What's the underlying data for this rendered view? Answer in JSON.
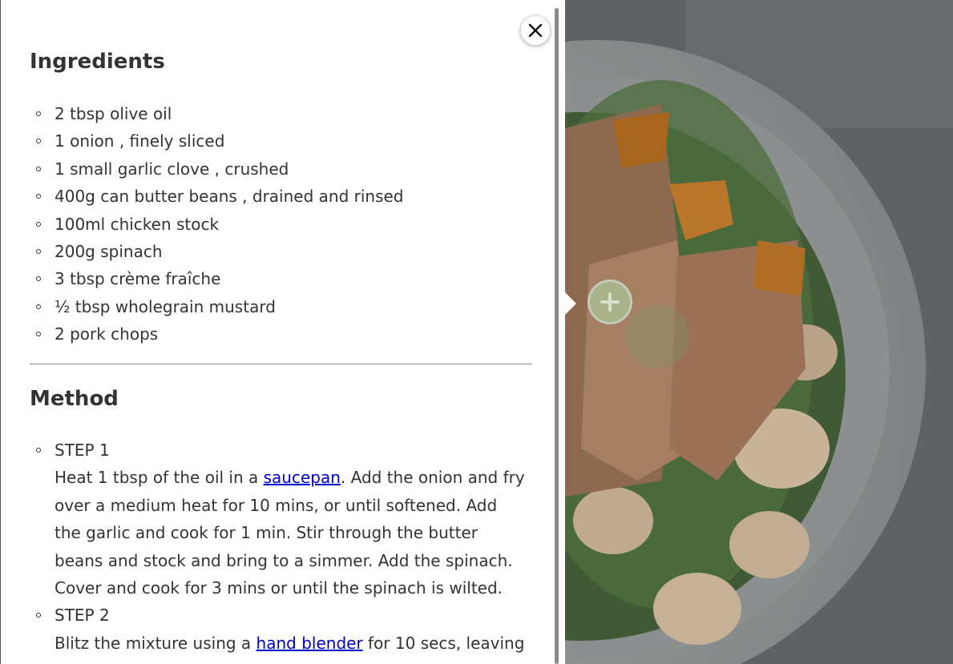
{
  "ingredients": {
    "title": "Ingredients",
    "items": [
      "2 tbsp olive oil",
      "1 onion , finely sliced",
      "1 small garlic clove , crushed",
      "400g can butter beans , drained and rinsed",
      "100ml chicken stock",
      "200g spinach",
      "3 tbsp crème fraîche",
      "½ tbsp wholegrain mustard",
      "2 pork chops"
    ]
  },
  "method": {
    "title": "Method",
    "steps": [
      {
        "label": "STEP 1",
        "text_before": "Heat 1 tbsp of the oil in a ",
        "link": "saucepan",
        "text_after": ". Add the onion and fry over a medium heat for 10 mins, or until softened. Add the garlic and cook for 1 min. Stir through the butter beans and stock and bring to a simmer. Add the spinach. Cover and cook for 3 mins or until the spinach is wilted."
      },
      {
        "label": "STEP 2",
        "text_before": "Blitz the mixture using a ",
        "link": "hand blender",
        "text_after": " for 10 secs, leaving"
      }
    ]
  },
  "icons": {
    "close": "close-icon",
    "add": "plus-icon"
  },
  "colors": {
    "link": "#0000cc",
    "add_button": "#aac396",
    "photo_overlay": "#5e6264"
  }
}
